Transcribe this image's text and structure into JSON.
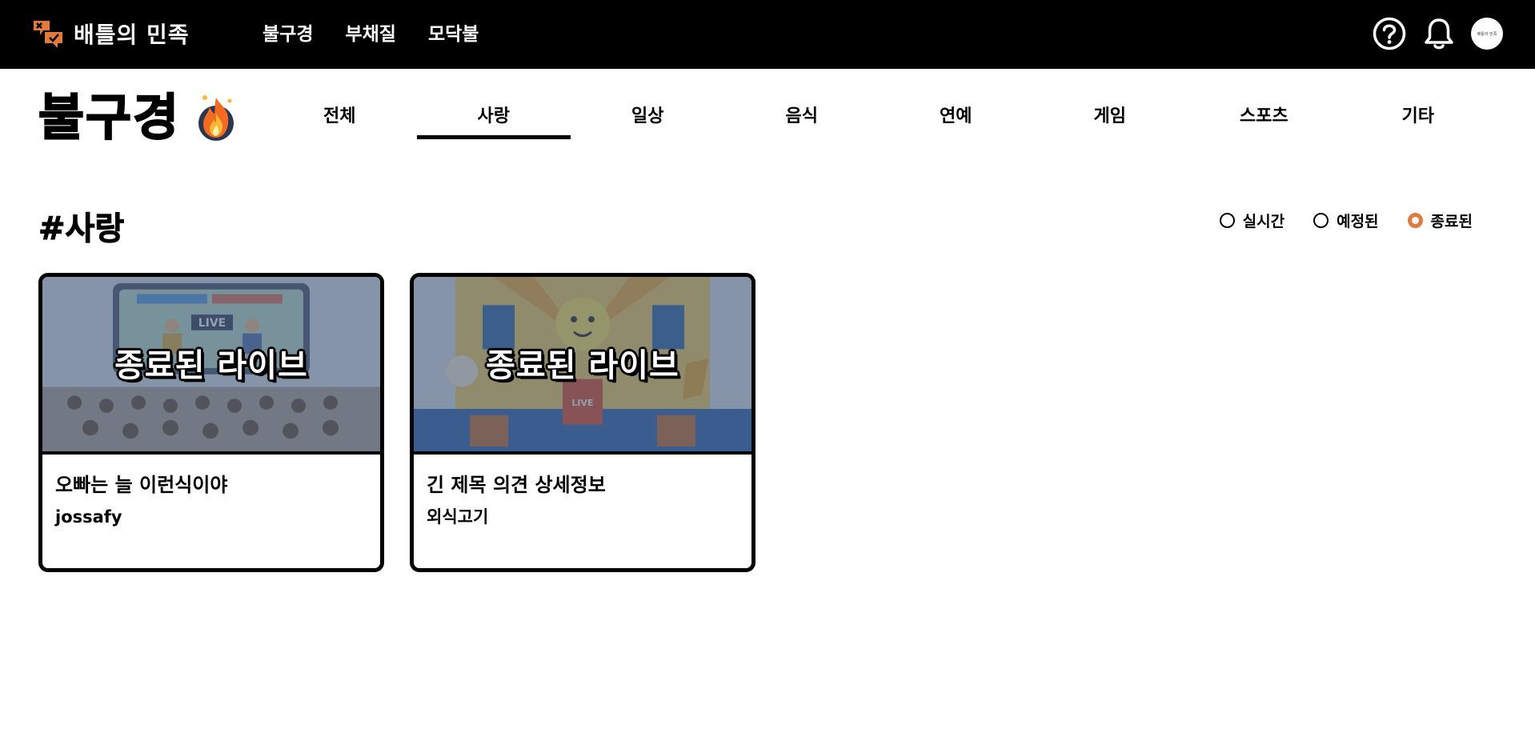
{
  "brand": {
    "name": "배틀의 민족",
    "logo_icon": "battle-logo-icon",
    "accent": "#e07a3f"
  },
  "topnav": [
    {
      "label": "불구경"
    },
    {
      "label": "부채질"
    },
    {
      "label": "모닥불"
    }
  ],
  "top_icons": {
    "help": "help-icon",
    "notifications": "bell-icon",
    "avatar_text": "배틀의 민족"
  },
  "page": {
    "title": "불구경",
    "title_icon": "fire-icon"
  },
  "categories": [
    {
      "label": "전체",
      "active": false
    },
    {
      "label": "사랑",
      "active": true
    },
    {
      "label": "일상",
      "active": false
    },
    {
      "label": "음식",
      "active": false
    },
    {
      "label": "연예",
      "active": false
    },
    {
      "label": "게임",
      "active": false
    },
    {
      "label": "스포츠",
      "active": false
    },
    {
      "label": "기타",
      "active": false
    }
  ],
  "section": {
    "title": "#사랑"
  },
  "filters": [
    {
      "label": "실시간",
      "checked": false
    },
    {
      "label": "예정된",
      "checked": false
    },
    {
      "label": "종료된",
      "checked": true
    }
  ],
  "cards": [
    {
      "overlay": "종료된 라이브",
      "title": "오빠는 늘 이런식이야",
      "author": "jossafy",
      "thumbnail": "live-debate-stage-scene"
    },
    {
      "overlay": "종료된 라이브",
      "title": "긴 제목 의견 상세정보",
      "author": "외식고기",
      "thumbnail": "live-cartoon-battle-scene"
    }
  ]
}
